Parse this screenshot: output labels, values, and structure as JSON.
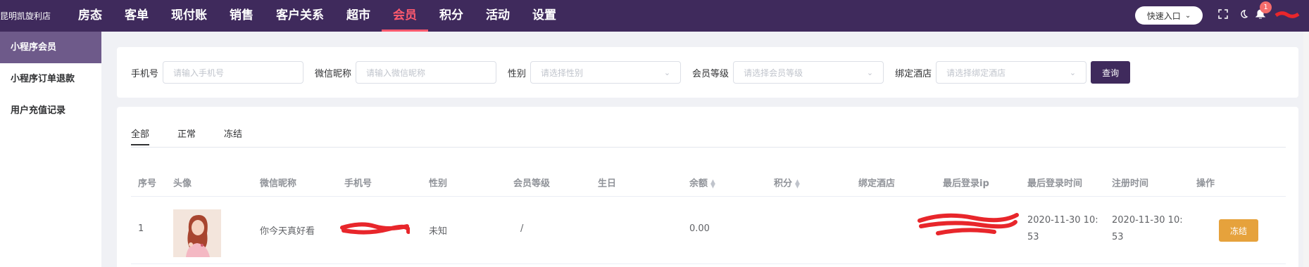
{
  "topbar": {
    "store_name": "昆明凯旋利店",
    "nav": [
      "房态",
      "客单",
      "现付账",
      "销售",
      "客户关系",
      "超市",
      "会员",
      "积分",
      "活动",
      "设置"
    ],
    "active_nav": "会员",
    "quick_entry": "快速入口",
    "notification_count": "1"
  },
  "sidebar": {
    "items": [
      "小程序会员",
      "小程序订单退款",
      "用户充值记录"
    ]
  },
  "filters": {
    "phone_label": "手机号",
    "phone_placeholder": "请输入手机号",
    "nickname_label": "微信昵称",
    "nickname_placeholder": "请输入微信昵称",
    "gender_label": "性别",
    "gender_placeholder": "请选择性别",
    "level_label": "会员等级",
    "level_placeholder": "请选择会员等级",
    "hotel_label": "绑定酒店",
    "hotel_placeholder": "请选择绑定酒店",
    "query_button": "查询"
  },
  "tabs": [
    "全部",
    "正常",
    "冻结"
  ],
  "table": {
    "headers": [
      "序号",
      "头像",
      "微信昵称",
      "手机号",
      "性别",
      "会员等级",
      "生日",
      "余额",
      "积分",
      "绑定酒店",
      "最后登录ip",
      "最后登录时间",
      "注册时间",
      "操作"
    ],
    "rows": [
      {
        "index": "1",
        "nickname": "你今天真好看",
        "gender": "未知",
        "level": "/",
        "balance": "0.00",
        "last_login_line1": "2020-11-30 10:",
        "last_login_line2": "53",
        "register_line1": "2020-11-30 10:",
        "register_line2": "53",
        "action": "冻结"
      }
    ]
  },
  "colors": {
    "brand": "#3f2a5c",
    "active_nav": "#ff5a6e",
    "freeze_button": "#e6a23c",
    "redaction": "#e8262b"
  }
}
